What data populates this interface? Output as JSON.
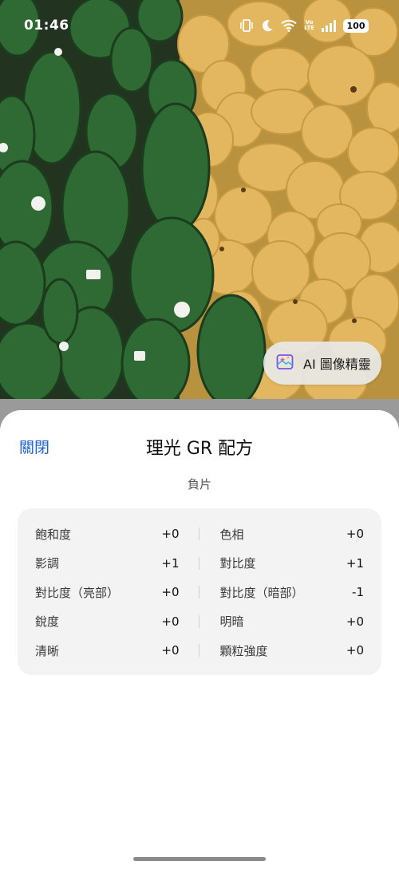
{
  "status_bar": {
    "time": "01:46",
    "icons": [
      "vibrate-icon",
      "moon-icon",
      "wifi-icon",
      "volte-icon",
      "signal-icon"
    ],
    "volte_top": "Vo",
    "volte_bottom": "LTE",
    "battery": "100"
  },
  "photo": {
    "description_icon": "avocado-mango-photo"
  },
  "ai_button": {
    "label": "AI 圖像精靈",
    "icon": "sparkle-icon"
  },
  "sheet": {
    "close_label": "關閉",
    "title": "理光 GR 配方",
    "subtitle": "負片",
    "rows": [
      {
        "left_name": "飽和度",
        "left_value": "+0",
        "right_name": "色相",
        "right_value": "+0"
      },
      {
        "left_name": "影調",
        "left_value": "+1",
        "right_name": "對比度",
        "right_value": "+1"
      },
      {
        "left_name": "對比度（亮部）",
        "left_value": "+0",
        "right_name": "對比度（暗部）",
        "right_value": "-1"
      },
      {
        "left_name": "銳度",
        "left_value": "+0",
        "right_name": "明暗",
        "right_value": "+0"
      },
      {
        "left_name": "清晰",
        "left_value": "+0",
        "right_name": "顆粒強度",
        "right_value": "+0"
      }
    ]
  },
  "colors": {
    "link": "#1f5fd6",
    "card_bg": "#f3f3f3"
  }
}
